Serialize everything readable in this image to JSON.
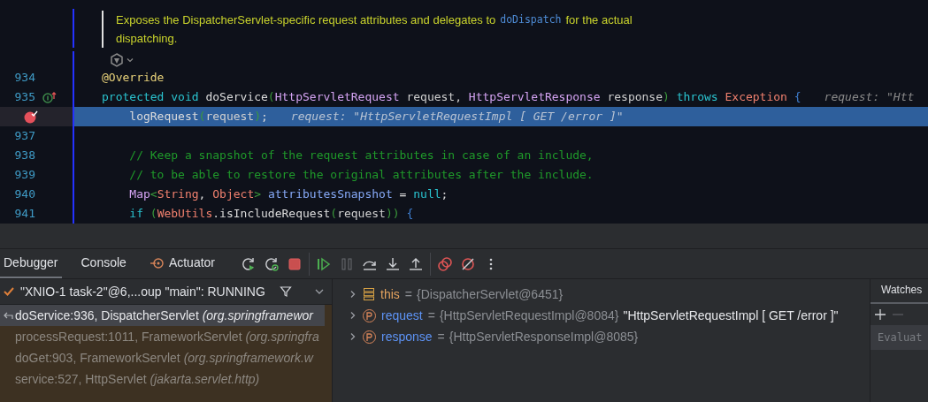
{
  "editor": {
    "doc_comment": [
      [
        {
          "text": "Exposes the DispatcherServlet-specific request attributes and delegates to",
          "kind": "text"
        },
        {
          "text": "doDispatch",
          "kind": "code"
        },
        {
          "text": "for the actual",
          "kind": "text"
        }
      ],
      [
        {
          "text": "dispatching.",
          "kind": "text"
        }
      ]
    ],
    "lines": [
      {
        "number": "934",
        "kind": "code",
        "current": false,
        "tokens": [
          {
            "text": "@Override",
            "kind": "annotation"
          }
        ]
      },
      {
        "number": "935",
        "kind": "implements",
        "current": false,
        "tokens": [
          {
            "text": "protected void ",
            "kind": "keyword"
          },
          {
            "text": "doService",
            "kind": "method"
          },
          {
            "text": "(",
            "kind": "paren"
          },
          {
            "text": "HttpServletRequest",
            "kind": "type"
          },
          {
            "text": " request, ",
            "kind": "param"
          },
          {
            "text": "HttpServletResponse",
            "kind": "type"
          },
          {
            "text": " response",
            "kind": "param"
          },
          {
            "text": ")",
            "kind": "paren"
          },
          {
            "text": " throws ",
            "kind": "keyword"
          },
          {
            "text": "Exception",
            "kind": "exception"
          },
          {
            "text": " {",
            "kind": "brace"
          }
        ],
        "hint": "request: \"Htt"
      },
      {
        "kind": "breakpoint",
        "current": true,
        "tokens": [
          {
            "text": "    logRequest",
            "kind": "method"
          },
          {
            "text": "(",
            "kind": "paren"
          },
          {
            "text": "request",
            "kind": "param"
          },
          {
            "text": ")",
            "kind": "paren"
          },
          {
            "text": ";",
            "kind": "method"
          }
        ],
        "hint": "request: \"HttpServletRequestImpl [ GET /error ]\""
      },
      {
        "number": "937",
        "kind": "code",
        "current": false
      },
      {
        "number": "938",
        "kind": "code",
        "current": false,
        "tokens": [
          {
            "text": "    // Keep a snapshot of the request attributes in case of an include,",
            "kind": "comment"
          }
        ]
      },
      {
        "number": "939",
        "kind": "code",
        "current": false,
        "tokens": [
          {
            "text": "    // to be able to restore the original attributes after the include.",
            "kind": "comment"
          }
        ]
      },
      {
        "number": "940",
        "kind": "code",
        "current": false,
        "tokens": [
          {
            "text": "    Map",
            "kind": "type"
          },
          {
            "text": "<",
            "kind": "paren"
          },
          {
            "text": "String",
            "kind": "exception"
          },
          {
            "text": ", ",
            "kind": "method"
          },
          {
            "text": "Object",
            "kind": "exception"
          },
          {
            "text": "> ",
            "kind": "paren"
          },
          {
            "text": "attributesSnapshot",
            "kind": "field"
          },
          {
            "text": " = ",
            "kind": "method"
          },
          {
            "text": "null",
            "kind": "keyword"
          },
          {
            "text": ";",
            "kind": "method"
          }
        ]
      },
      {
        "number": "941",
        "kind": "code",
        "current": false,
        "tokens": [
          {
            "text": "    if ",
            "kind": "keyword"
          },
          {
            "text": "(",
            "kind": "paren"
          },
          {
            "text": "WebUtils",
            "kind": "exception"
          },
          {
            "text": ".isIncludeRequest",
            "kind": "method"
          },
          {
            "text": "(",
            "kind": "paren"
          },
          {
            "text": "request",
            "kind": "param"
          },
          {
            "text": "))",
            "kind": "paren"
          },
          {
            "text": " {",
            "kind": "brace"
          }
        ]
      }
    ]
  },
  "debug_panel": {
    "tabs": [
      {
        "label": "Debugger",
        "selected": true,
        "kind": "plain"
      },
      {
        "label": "Console",
        "selected": false,
        "kind": "plain"
      },
      {
        "label": "Actuator",
        "selected": false,
        "kind": "actuator"
      }
    ],
    "toolbar": [
      [
        {
          "kind": "rerun",
          "disabled": false
        },
        {
          "kind": "rerun_debug",
          "disabled": false
        },
        {
          "kind": "stop",
          "disabled": false
        }
      ],
      [
        {
          "kind": "resume",
          "disabled": false
        },
        {
          "kind": "pause",
          "disabled": true
        },
        {
          "kind": "step_over",
          "disabled": false
        },
        {
          "kind": "step_into",
          "disabled": false
        },
        {
          "kind": "step_out",
          "disabled": false
        }
      ],
      [
        {
          "kind": "breakpoints",
          "disabled": false
        },
        {
          "kind": "mute",
          "disabled": false
        },
        {
          "kind": "more",
          "disabled": false
        }
      ]
    ],
    "thread": "\"XNIO-1 task-2\"@6,...oup \"main\": RUNNING",
    "frames": [
      {
        "method": "doService:936, DispatcherServlet",
        "package": "(org.springframewor",
        "selected": true,
        "library": false
      },
      {
        "method": "processRequest:1011, FrameworkServlet",
        "package": "(org.springfra",
        "selected": false,
        "library": true
      },
      {
        "method": "doGet:903, FrameworkServlet",
        "package": "(org.springframework.w",
        "selected": false,
        "library": true
      },
      {
        "method": "service:527, HttpServlet",
        "package": "(jakarta.servlet.http)",
        "selected": false,
        "library": true
      }
    ],
    "variables": [
      {
        "kind": "this",
        "name": "this",
        "operator": "=",
        "value": "{DispatcherServlet@6451}"
      },
      {
        "kind": "param",
        "name": "request",
        "operator": "=",
        "value": "{HttpServletRequestImpl@8084}",
        "string": "\"HttpServletRequestImpl [ GET /error ]\""
      },
      {
        "kind": "param",
        "name": "response",
        "operator": "=",
        "value": "{HttpServletResponseImpl@8085}"
      }
    ],
    "watches": {
      "title": "Watches",
      "remove_disabled": true,
      "placeholder": "Evaluat"
    }
  }
}
